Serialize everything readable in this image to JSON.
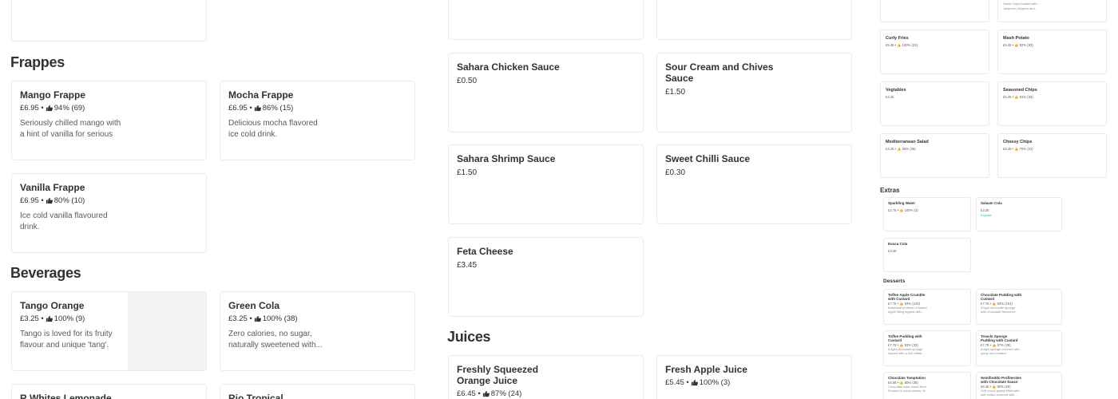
{
  "colors": {
    "accent": "#00ccbc",
    "text": "#2e3333",
    "muted": "#585c5c",
    "border": "#eaeaea"
  },
  "icons": {
    "rating": "thumbs-up-icon"
  },
  "col1": {
    "frappes_title": "Frappes",
    "beverages_title": "Beverages",
    "frappes": [
      {
        "name": "Mango Frappe",
        "price": "£6.95 •",
        "rating": "94% (69)",
        "desc_1": "Seriously chilled mango with",
        "desc_2": "a hint of vanilla for serious",
        "desc_3": ""
      },
      {
        "name": "Mocha Frappe",
        "price": "£6.95 •",
        "rating": "86% (15)",
        "desc_1": "Delicious mocha flavored",
        "desc_2": "ice cold drink."
      },
      {
        "name": "Vanilla Frappe",
        "price": "£6.95 •",
        "rating": "80% (10)",
        "desc_1": "Ice cold vanilla flavoured",
        "desc_2": "drink."
      }
    ],
    "beverages": [
      {
        "name": "Tango Orange",
        "price": "£3.25 •",
        "rating": "100% (9)",
        "desc_1": "Tango is loved for its fruity",
        "desc_2": "flavour and unique 'tang'."
      },
      {
        "name": "Green Cola",
        "price": "£3.25 •",
        "rating": "100% (38)",
        "desc_1": "Zero calories, no sugar,",
        "desc_2": "naturally sweetened with..."
      },
      {
        "name": "R Whites Lemonade"
      },
      {
        "name": "Rio Tropical"
      }
    ]
  },
  "col2": {
    "sauces": [
      {
        "name": "Sahara Chicken Sauce",
        "price": "£0.50"
      },
      {
        "name": "Sour Cream and Chives",
        "name_2": "Sauce",
        "price": "£1.50"
      },
      {
        "name": "Sahara Shrimp Sauce",
        "price": "£1.50"
      },
      {
        "name": "Sweet Chilli Sauce",
        "price": "£0.30"
      },
      {
        "name": "Feta Cheese",
        "price": "£3.45"
      }
    ],
    "juices_title": "Juices",
    "juices": [
      {
        "name": "Freshly Squeezed",
        "name_2": "Orange Juice",
        "price": "£6.45 •",
        "rating": "87% (24)"
      },
      {
        "name": "Fresh Apple Juice",
        "price": "£5.45 •",
        "rating": "100% (3)"
      }
    ]
  },
  "col3": {
    "top_desc_1": "Salsa Chips loaded with",
    "top_desc_2": "Jalapeno peppers and...",
    "sides": [
      {
        "name": "Curly Fries",
        "meta": "£5.45 • 👍 100% (22)"
      },
      {
        "name": "Mash Potato",
        "meta": "£5.45 • 👍 92% (93)"
      },
      {
        "name": "Vegtables",
        "meta": "£4.25"
      },
      {
        "name": "Seasoned Chips",
        "meta": "£5.25 • 👍 81% (33)"
      },
      {
        "name": "Mediterranean Salad",
        "meta": "£4.25 • 👍 55% (36)"
      },
      {
        "name": "Cheesy Chips",
        "meta": "£5.45 • 👍 75% (24)"
      }
    ],
    "extras_title": "Extras",
    "extras": [
      {
        "name": "Sparkling Water",
        "meta": "£2.75 • 👍 100% (3)"
      },
      {
        "name": "Salaam Cola",
        "meta": "£3.25",
        "tag": "Popular"
      },
      {
        "name": "Evoca Cola",
        "meta": "£3.25"
      }
    ],
    "desserts_title": "Desserts",
    "desserts": [
      {
        "name": "Toffee Apple Crumble",
        "name_2": "with Custard",
        "meta": "£7.75 • 👍 93% (120)",
        "d1": "Individual portions of baked",
        "d2": "apple filling topped with..."
      },
      {
        "name": "Chocolate Pudding with",
        "name_2": "Custard",
        "meta": "£7.75 • 👍 93% (101)",
        "d1": "A light chocolate sponge",
        "d2": "with chocolate flavoured..."
      },
      {
        "name": "Toffee Pudding with",
        "name_2": "Custard",
        "meta": "£7.75 • 👍 93% (33)",
        "d1": "A light chocolate sponge",
        "d2": "topped with a rich toffee..."
      },
      {
        "name": "Treacle Sponge",
        "name_2": "Pudding with Custard",
        "meta": "£7.75 • 👍 97% (28)",
        "d1": "A light sponge covered with",
        "d2": "syrup and custard."
      },
      {
        "name": "Chocolate Temptation",
        "name_2": "",
        "meta": "£6.95 • 👍 80% (30)",
        "d1": "Chocolate cake made from",
        "d2": "Ecuador's cocoa seeds, fil..."
      },
      {
        "name": "Semifreddo Profiteroles",
        "name_2": "with Chocolate Sauce",
        "meta": "£6.45 • 👍 90% (20)",
        "d1": "Soft choux pastry filled with",
        "d2": "soft cream covered with..."
      }
    ]
  }
}
